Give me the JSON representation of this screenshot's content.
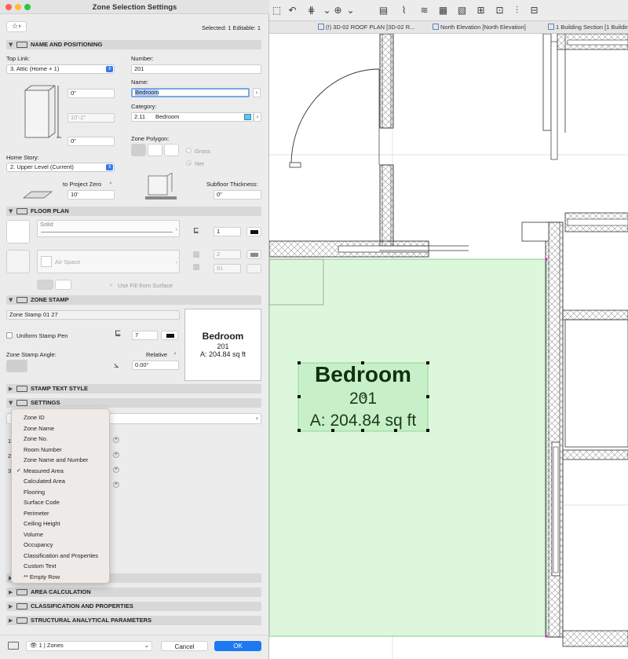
{
  "dialog": {
    "title": "Zone Selection Settings",
    "selection_info": "Selected: 1 Editable: 1",
    "favorites_icon": "star-icon",
    "sections": {
      "name_positioning": "NAME AND POSITIONING",
      "floor_plan": "FLOOR PLAN",
      "zone_stamp": "ZONE STAMP",
      "stamp_text_style": "STAMP TEXT STYLE",
      "settings": "SETTINGS",
      "area_calculation": "AREA CALCULATION",
      "classification": "CLASSIFICATION AND PROPERTIES",
      "structural": "STRUCTURAL ANALYTICAL PARAMETERS"
    },
    "top_link": {
      "label": "Top Link:",
      "value": "3. Attic (Home + 1)"
    },
    "height_offset_top": "0\"",
    "height_total": "10'-2\"",
    "height_offset_bottom": "0\"",
    "home_story": {
      "label": "Home Story:",
      "value": "2. Upper Level (Current)"
    },
    "to_project_zero": {
      "label": "to Project Zero",
      "value": "10'"
    },
    "number": {
      "label": "Number:",
      "value": "201"
    },
    "name": {
      "label": "Name:",
      "value": "Bedroom"
    },
    "category": {
      "label": "Category:",
      "code": "2.11",
      "value": "Bedroom",
      "color": "#5ec8ea"
    },
    "zone_polygon": {
      "label": "Zone Polygon:",
      "gross": "Gross",
      "net": "Net"
    },
    "subfloor": {
      "label": "Subfloor Thickness:",
      "value": "0\""
    },
    "floor_plan": {
      "fill_type": "Solid",
      "pen1": "1",
      "cover_fill": "Air Space",
      "pen2": "2",
      "pen3": "91",
      "use_fill_from_surface": "Use Fill from Surface"
    },
    "zone_stamp": {
      "stamp_name": "Zone Stamp 01 27",
      "uniform_pen": "Uniform Stamp Pen",
      "pen": "7",
      "angle_label": "Zone Stamp Angle:",
      "relative": "Relative",
      "angle": "0.00°",
      "preview": {
        "name": "Bedroom",
        "number": "201",
        "area": "A: 204.84 sq ft"
      }
    },
    "settings_rows": [
      "1",
      "2",
      "3"
    ],
    "menu_items": [
      {
        "label": "Zone ID",
        "checked": false
      },
      {
        "label": "Zone Name",
        "checked": false
      },
      {
        "label": "Zone No.",
        "checked": false
      },
      {
        "label": "Room Number",
        "checked": false
      },
      {
        "label": "Zone Name and Number",
        "checked": false
      },
      {
        "label": "Measured Area",
        "checked": true
      },
      {
        "label": "Calculated Area",
        "checked": false
      },
      {
        "label": "Flooring",
        "checked": false
      },
      {
        "label": "Surface Code",
        "checked": false
      },
      {
        "label": "Perimeter",
        "checked": false
      },
      {
        "label": "Ceiling Height",
        "checked": false
      },
      {
        "label": "Volume",
        "checked": false
      },
      {
        "label": "Occupancy",
        "checked": false
      },
      {
        "label": "Classification and Properties",
        "checked": false
      },
      {
        "label": "Custom Text",
        "checked": false
      },
      {
        "label": "** Empty Row",
        "checked": false
      }
    ],
    "layer": "1 | Zones",
    "cancel": "Cancel",
    "ok": "OK"
  },
  "cad": {
    "tabs": [
      {
        "label": "(!) 3D-02 ROOF PLAN [3D-02 R..."
      },
      {
        "label": "North Elevation [North Elevation]"
      },
      {
        "label": "1 Building Section [1 Building Se..."
      }
    ],
    "stamp": {
      "name": "Bedroom",
      "number": "201",
      "area": "A: 204.84 sq ft"
    },
    "zone_fill_color": "#dcf7dc"
  }
}
